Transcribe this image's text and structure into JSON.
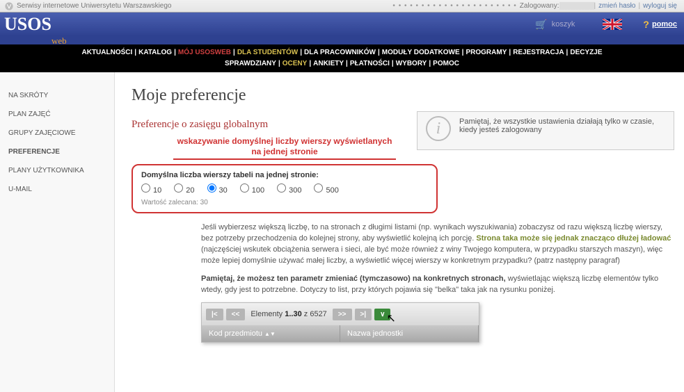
{
  "top_bar": {
    "uw_label": "Serwisy internetowe Uniwersytetu Warszawskiego",
    "logged_label": "Zalogowany:",
    "change_password": "zmień hasło",
    "logout": "wyloguj się"
  },
  "blue_bar": {
    "logo_main": "USOS",
    "logo_sub": "web",
    "cart": "koszyk",
    "help": "pomoc"
  },
  "menu": {
    "items": [
      {
        "label": "AKTUALNOŚCI"
      },
      {
        "label": "KATALOG"
      },
      {
        "label": "MÓJ USOSWEB",
        "hl": "red"
      },
      {
        "label": "DLA STUDENTÓW",
        "hl": "yellow"
      },
      {
        "label": "DLA PRACOWNIKÓW"
      },
      {
        "label": "MODUŁY DODATKOWE"
      },
      {
        "label": "PROGRAMY"
      },
      {
        "label": "REJESTRACJA"
      },
      {
        "label": "DECYZJE"
      },
      {
        "label": "SPRAWDZIANY"
      },
      {
        "label": "OCENY",
        "hl": "yellow"
      },
      {
        "label": "ANKIETY"
      },
      {
        "label": "PŁATNOŚCI"
      },
      {
        "label": "WYBORY"
      },
      {
        "label": "POMOC"
      }
    ]
  },
  "sidebar": {
    "items": [
      {
        "label": "NA SKRÓTY"
      },
      {
        "label": "PLAN ZAJĘĆ"
      },
      {
        "label": "GRUPY ZAJĘCIOWE"
      },
      {
        "label": "PREFERENCJE",
        "active": true
      },
      {
        "label": "PLANY UŻYTKOWNIKA"
      },
      {
        "label": "U-MAIL"
      }
    ]
  },
  "content": {
    "h1": "Moje preferencje",
    "h2": "Preferencje o zasięgu globalnym",
    "annotation": "wskazywanie domyślnej liczby wierszy wyświetlanych na jednej stronie",
    "info_text": "Pamiętaj, że wszystkie ustawienia działają tylko w czasie, kiedy jesteś zalogowany",
    "pref_label": "Domyślna liczba wierszy tabeli na jednej stronie:",
    "options": [
      "10",
      "20",
      "30",
      "100",
      "300",
      "500"
    ],
    "selected": "30",
    "recommended": "Wartość zalecana: 30",
    "para1_a": "Jeśli wybierzesz większą liczbę, to na stronach z długimi listami (np. wynikach wyszukiwania) zobaczysz od razu większą liczbę wierszy, bez potrzeby przechodzenia do kolejnej strony, aby wyświetlić kolejną ich porcję. ",
    "para1_hl": "Strona taka może się jednak znacząco dłużej ładować ",
    "para1_b": "(najczęściej wskutek obciążenia serwera i sieci, ale być może również z winy Twojego komputera, w przypadku starszych maszyn), więc może lepiej domyślnie używać małej liczby, a wyświetlić więcej wierszy w konkretnym przypadku? (patrz następny paragraf)",
    "para2_b": "Pamiętaj, że możesz ten parametr zmieniać (tymczasowo) na konkretnych stronach,",
    "para2_a": " wyświetlając większą liczbę elementów tylko wtedy, gdy jest to potrzebne. Dotyczy to list, przy których pojawia się \"belka\" taka jak na rysunku poniżej.",
    "pager": {
      "first": "|<",
      "prev": "<<",
      "label_a": "Elementy ",
      "label_b": "1..30",
      "label_c": " z 6527",
      "next": ">>",
      "last": ">|",
      "go": "∨",
      "col1": "Kod przedmiotu",
      "col2": "Nazwa jednostki"
    }
  }
}
